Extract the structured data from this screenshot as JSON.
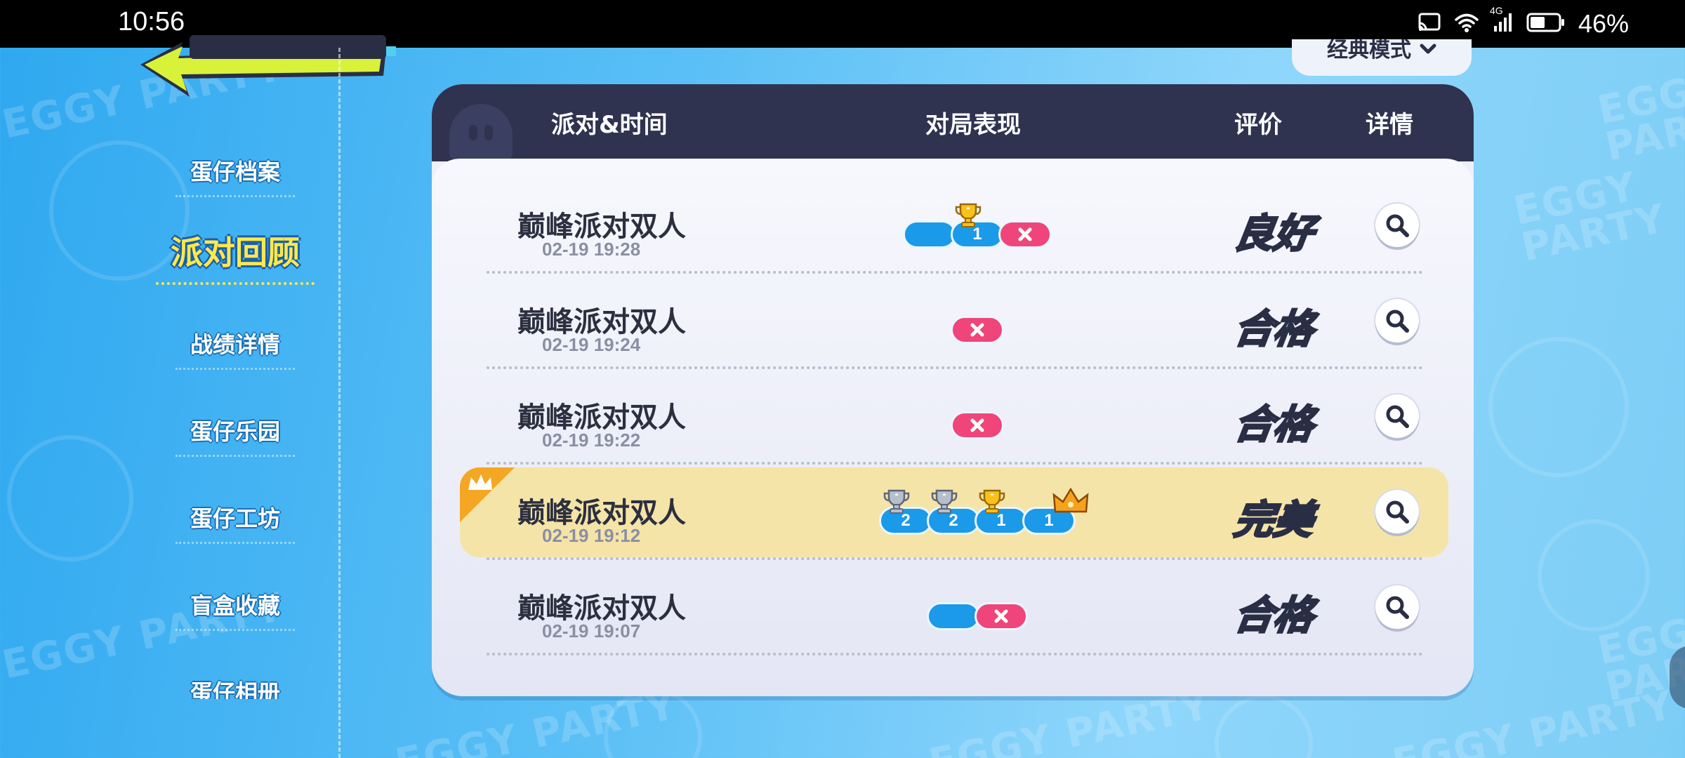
{
  "status_bar": {
    "time": "10:56",
    "network": "4G",
    "battery": "46%"
  },
  "background": {
    "watermark": "EGGY PARTY"
  },
  "sidebar": {
    "items": [
      {
        "label": "蛋仔档案",
        "active": false
      },
      {
        "label": "派对回顾",
        "active": true
      },
      {
        "label": "战绩详情",
        "active": false
      },
      {
        "label": "蛋仔乐园",
        "active": false
      },
      {
        "label": "蛋仔工坊",
        "active": false
      },
      {
        "label": "盲盒收藏",
        "active": false
      },
      {
        "label": "蛋仔相册",
        "active": false
      }
    ]
  },
  "mode_dropdown": {
    "label": "经典模式"
  },
  "table": {
    "headers": {
      "party_time": "派对&时间",
      "performance": "对局表现",
      "rating": "评价",
      "details": "详情"
    },
    "rows": [
      {
        "title": "巅峰派对双人",
        "date": "02-19 19:28",
        "rating": "良好",
        "rating_type": "good",
        "highlight": false,
        "performance": [
          {
            "type": "qualified"
          },
          {
            "type": "trophy",
            "value": "1",
            "medal": "gold"
          },
          {
            "type": "eliminated"
          }
        ]
      },
      {
        "title": "巅峰派对双人",
        "date": "02-19 19:24",
        "rating": "合格",
        "rating_type": "pass",
        "highlight": false,
        "performance": [
          {
            "type": "eliminated"
          }
        ]
      },
      {
        "title": "巅峰派对双人",
        "date": "02-19 19:22",
        "rating": "合格",
        "rating_type": "pass",
        "highlight": false,
        "performance": [
          {
            "type": "eliminated"
          }
        ]
      },
      {
        "title": "巅峰派对双人",
        "date": "02-19 19:12",
        "rating": "完美",
        "rating_type": "perfect",
        "highlight": true,
        "performance": [
          {
            "type": "trophy",
            "value": "2",
            "medal": "silver"
          },
          {
            "type": "trophy",
            "value": "2",
            "medal": "silver"
          },
          {
            "type": "trophy",
            "value": "1",
            "medal": "gold"
          },
          {
            "type": "crown",
            "value": "1",
            "medal": "crown"
          }
        ]
      },
      {
        "title": "巅峰派对双人",
        "date": "02-19 19:07",
        "rating": "合格",
        "rating_type": "pass",
        "highlight": false,
        "performance": [
          {
            "type": "qualified"
          },
          {
            "type": "eliminated"
          }
        ]
      }
    ]
  },
  "colors": {
    "header_bg": "#2f3350",
    "qualified_blue": "#1a9ae8",
    "eliminated_pink": "#f0457a",
    "highlight_row": "#f5e4a8",
    "active_nav": "#ffe94a"
  }
}
